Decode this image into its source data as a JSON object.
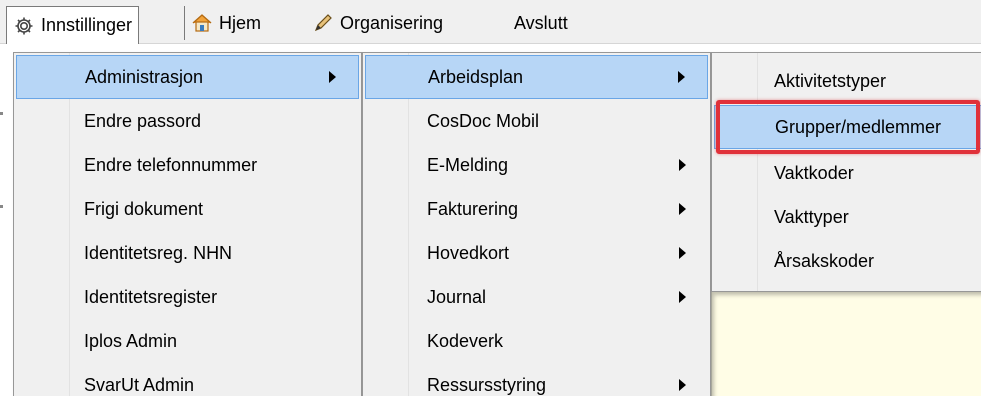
{
  "menubar": {
    "items": [
      {
        "label": "Innstillinger",
        "icon": "gear-icon"
      },
      {
        "label": "Hjem",
        "icon": "home-icon"
      },
      {
        "label": "Organisering",
        "icon": "pencil-icon"
      },
      {
        "label": "Avslutt",
        "icon": ""
      }
    ]
  },
  "menu_level1": {
    "items": [
      {
        "label": "Administrasjon",
        "submenu": true,
        "highlighted": true
      },
      {
        "label": "Endre passord"
      },
      {
        "label": "Endre telefonnummer"
      },
      {
        "label": "Frigi dokument"
      },
      {
        "label": "Identitetsreg. NHN"
      },
      {
        "label": "Identitetsregister"
      },
      {
        "label": "Iplos Admin"
      },
      {
        "label": "SvarUt Admin"
      }
    ]
  },
  "menu_level2": {
    "items": [
      {
        "label": "Arbeidsplan",
        "submenu": true,
        "highlighted": true
      },
      {
        "label": "CosDoc Mobil"
      },
      {
        "label": "E-Melding",
        "submenu": true
      },
      {
        "label": "Fakturering",
        "submenu": true
      },
      {
        "label": "Hovedkort",
        "submenu": true
      },
      {
        "label": "Journal",
        "submenu": true
      },
      {
        "label": "Kodeverk"
      },
      {
        "label": "Ressursstyring",
        "submenu": true
      }
    ]
  },
  "menu_level3": {
    "items": [
      {
        "label": "Aktivitetstyper"
      },
      {
        "label": "Grupper/medlemmer",
        "highlighted": true
      },
      {
        "label": "Vaktkoder"
      },
      {
        "label": "Vakttyper"
      },
      {
        "label": "Årsakskoder"
      }
    ]
  },
  "colors": {
    "highlight": "#b7d6f6",
    "highlight_border": "#6aa6e6",
    "annotation_red": "#e0313a",
    "menu_bg": "#f0f0f0"
  }
}
